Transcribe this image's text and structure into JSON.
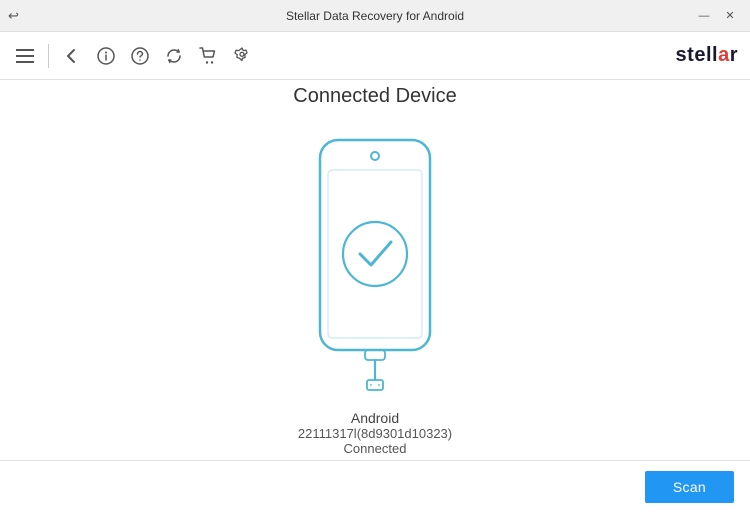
{
  "titlebar": {
    "title": "Stellar Data Recovery for Android",
    "back_icon": "↩",
    "minimize_label": "—",
    "close_label": "✕"
  },
  "toolbar": {
    "menu_icon": "☰",
    "back_icon": "←",
    "info_icon": "ⓘ",
    "help_icon": "?",
    "refresh_icon": "↻",
    "cart_icon": "🛒",
    "settings_icon": "🔧"
  },
  "logo": {
    "text_main": "stell",
    "text_accent": "a",
    "text_end": "r"
  },
  "main": {
    "title": "Connected Device",
    "device_name": "Android",
    "device_id": "22111317l(8d9301d10323)",
    "device_status": "Connected"
  },
  "footer": {
    "scan_button_label": "Scan"
  },
  "colors": {
    "phone_stroke": "#4db6d4",
    "check_stroke": "#4db6d4",
    "scan_button_bg": "#2196f3"
  }
}
